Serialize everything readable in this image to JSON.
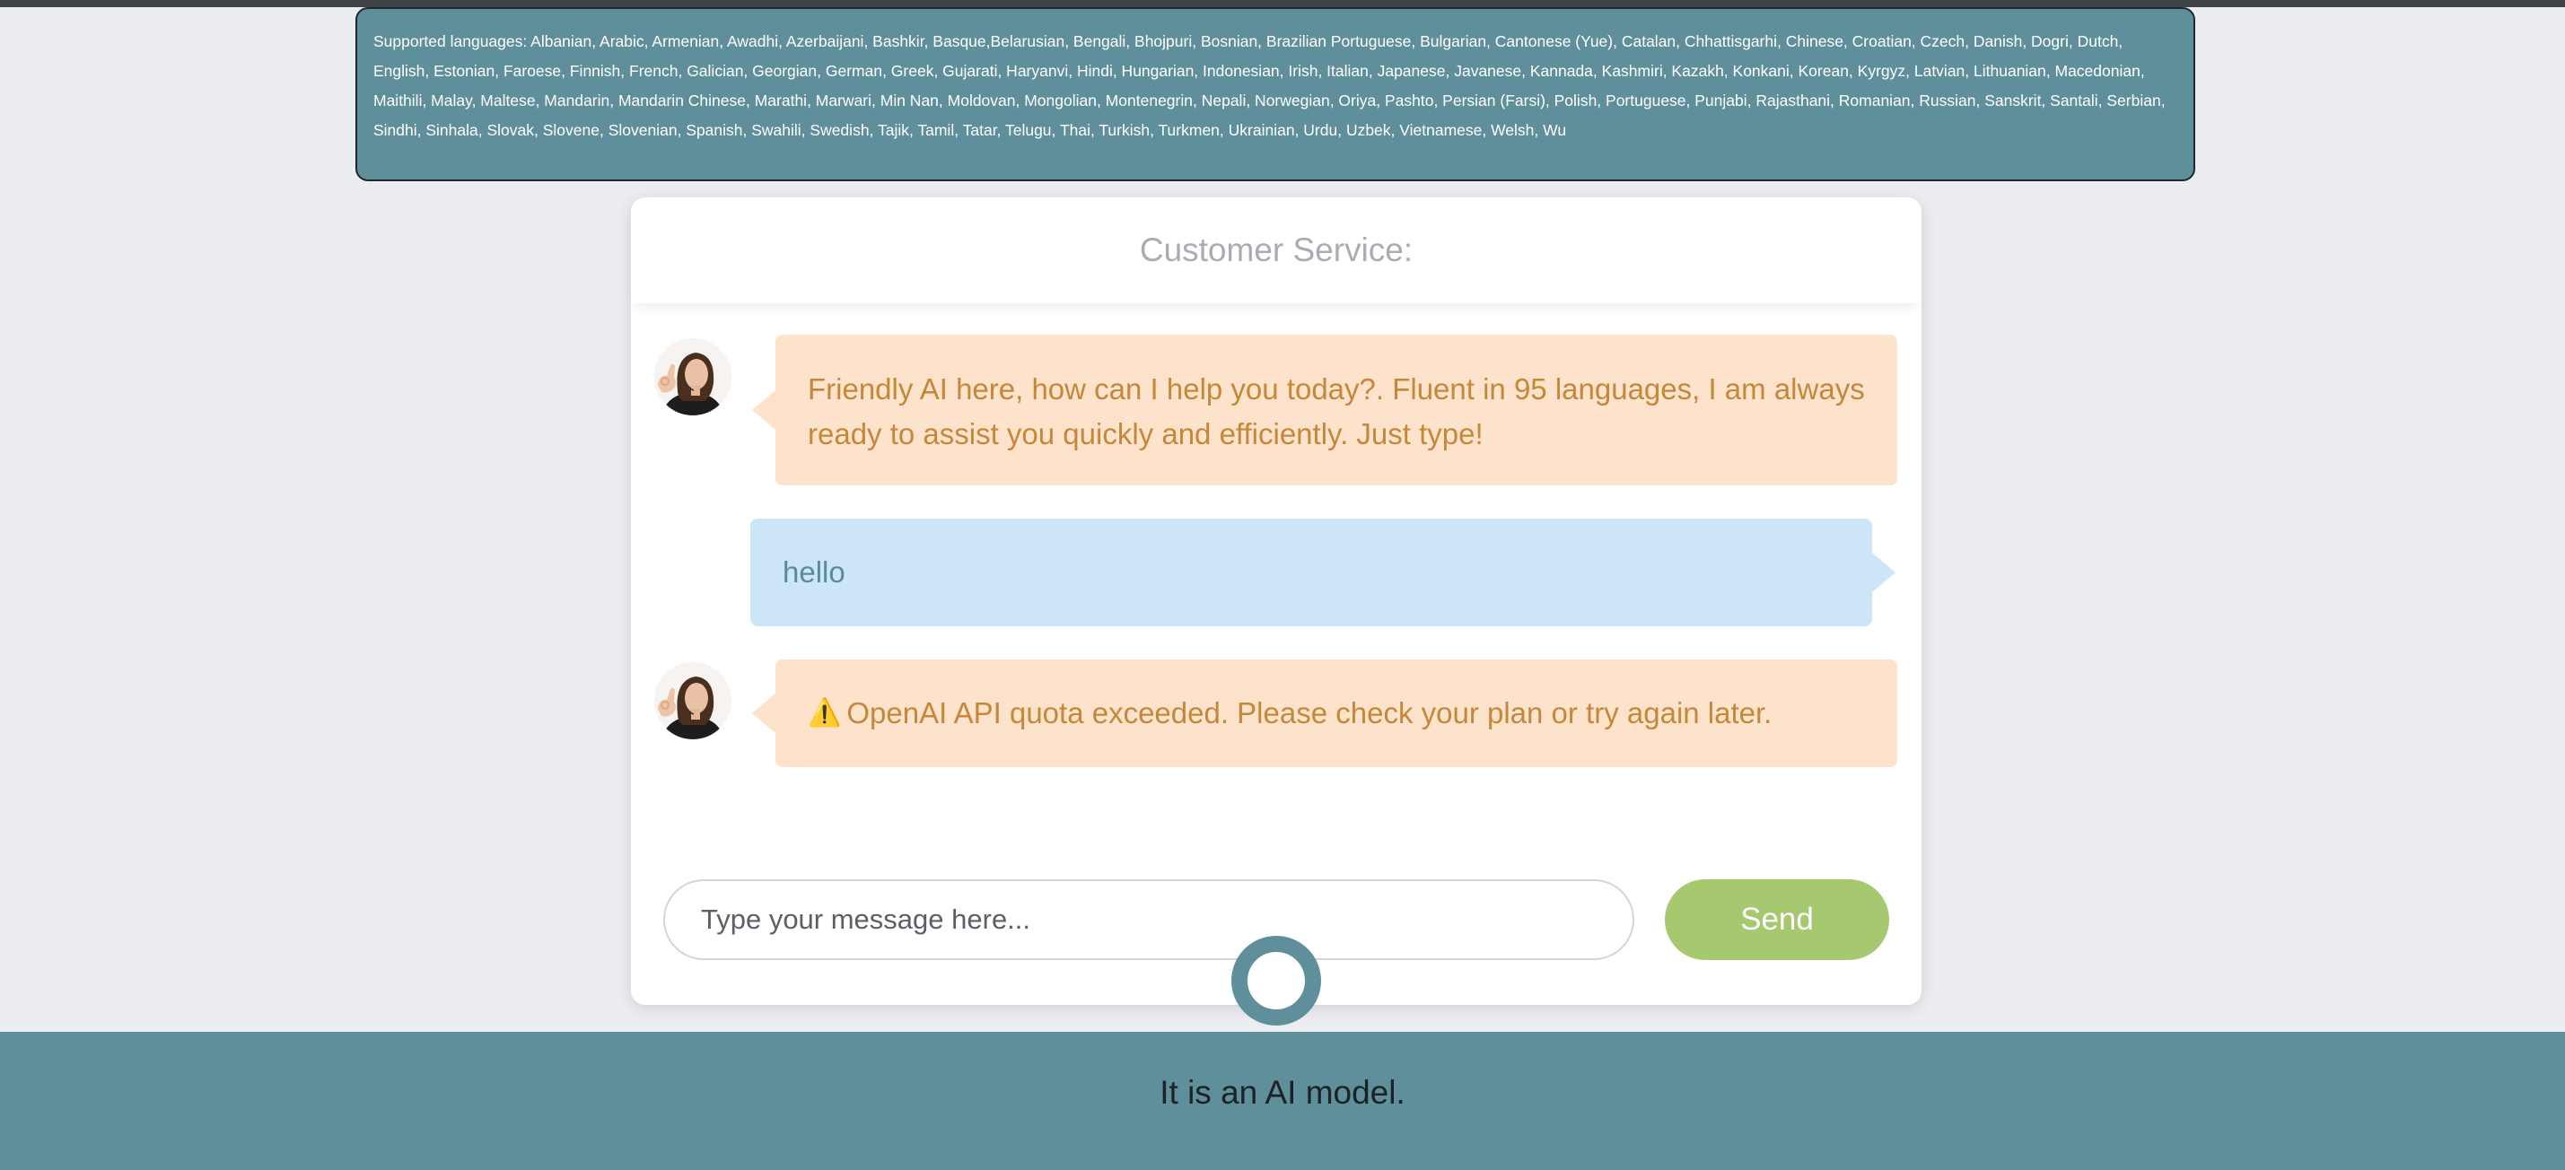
{
  "supported_languages": "Supported languages: Albanian, Arabic, Armenian, Awadhi, Azerbaijani, Bashkir, Basque,Belarusian, Bengali, Bhojpuri, Bosnian, Brazilian Portuguese, Bulgarian, Cantonese (Yue), Catalan, Chhattisgarhi, Chinese, Croatian, Czech, Danish, Dogri, Dutch, English, Estonian, Faroese, Finnish, French, Galician, Georgian, German, Greek, Gujarati, Haryanvi, Hindi, Hungarian, Indonesian, Irish, Italian, Japanese, Javanese, Kannada, Kashmiri, Kazakh, Konkani, Korean, Kyrgyz, Latvian, Lithuanian, Macedonian, Maithili, Malay, Maltese, Mandarin, Mandarin Chinese, Marathi, Marwari, Min Nan, Moldovan, Mongolian, Montenegrin, Nepali, Norwegian, Oriya, Pashto, Persian (Farsi), Polish, Portuguese, Punjabi, Rajasthani, Romanian, Russian, Sanskrit, Santali, Serbian, Sindhi, Sinhala, Slovak, Slovene, Slovenian, Spanish, Swahili, Swedish, Tajik, Tamil, Tatar, Telugu, Thai, Turkish, Turkmen, Ukrainian, Urdu, Uzbek, Vietnamese, Welsh, Wu",
  "chat": {
    "title": "Customer Service:",
    "messages": [
      {
        "sender": "bot",
        "text": "Friendly AI here, how can I help you today?. Fluent in 95 languages, I am always ready to assist you quickly and efficiently. Just type!"
      },
      {
        "sender": "user",
        "text": "hello"
      },
      {
        "sender": "bot",
        "icon": "⚠️",
        "text": "OpenAI API quota exceeded. Please check your plan or try again later."
      }
    ],
    "input_placeholder": "Type your message here...",
    "input_value": "",
    "send_label": "Send"
  },
  "footer": {
    "text": "It is an AI model."
  },
  "colors": {
    "accent": "#5f8f9a",
    "bot_bubble": "#fde3cb",
    "bot_text": "#c58838",
    "user_bubble": "#cce6f8",
    "user_text": "#5a8b9a",
    "send_button": "#a6c96f",
    "page_background": "#ecedf1"
  },
  "icons": {
    "avatar": "support-agent-avatar",
    "loading": "loading-spinner-icon"
  }
}
